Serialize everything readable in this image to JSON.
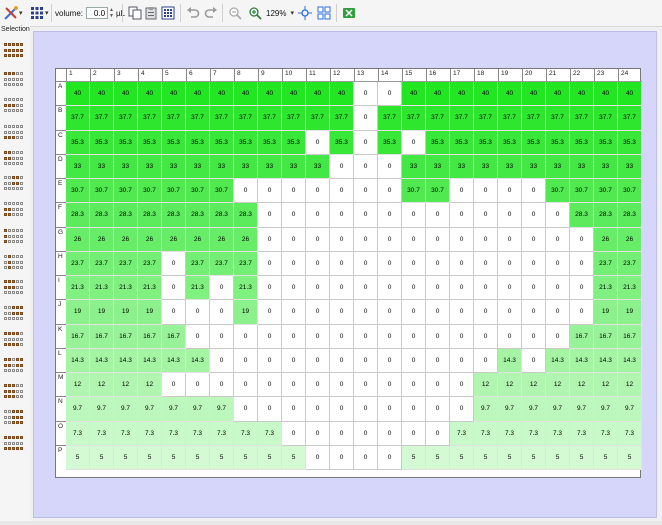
{
  "toolbar": {
    "volume_label": "volume:",
    "volume_value": "0.0",
    "volume_unit": "µL",
    "zoom_value": "129%",
    "icons": [
      "pipette-tool-icon",
      "plate-grid-icon",
      "copy-icon",
      "paste-icon",
      "plate-layout-icon",
      "undo-icon",
      "redo-icon",
      "zoom-out-icon",
      "zoom-in-icon",
      "fit-view-icon",
      "grid-view-icon",
      "export-excel-icon"
    ]
  },
  "sidebar": {
    "title": "Selection",
    "icons": [
      "select-all-icon",
      "select-rows-1-icon",
      "select-rows-2-icon",
      "select-rows-3-icon",
      "select-block-1-icon",
      "select-block-2-icon",
      "select-block-3-icon",
      "select-block-4-icon",
      "select-block-5-icon",
      "select-block-6-icon",
      "select-block-7-icon",
      "select-block-8-icon",
      "select-block-9-icon",
      "select-block-10-icon",
      "select-block-11-icon",
      "select-block-12-icon"
    ]
  },
  "plate": {
    "columns": [
      "1",
      "2",
      "3",
      "4",
      "5",
      "6",
      "7",
      "8",
      "9",
      "10",
      "11",
      "12",
      "13",
      "14",
      "15",
      "16",
      "17",
      "18",
      "19",
      "20",
      "21",
      "22",
      "23",
      "24"
    ],
    "rows": [
      "A",
      "B",
      "C",
      "D",
      "E",
      "F",
      "G",
      "H",
      "I",
      "J",
      "K",
      "L",
      "M",
      "N",
      "O",
      "P"
    ],
    "values": [
      [
        "40",
        "40",
        "40",
        "40",
        "40",
        "40",
        "40",
        "40",
        "40",
        "40",
        "40",
        "40",
        "0",
        "0",
        "40",
        "40",
        "40",
        "40",
        "40",
        "40",
        "40",
        "40",
        "40",
        "40"
      ],
      [
        "37.7",
        "37.7",
        "37.7",
        "37.7",
        "37.7",
        "37.7",
        "37.7",
        "37.7",
        "37.7",
        "37.7",
        "37.7",
        "37.7",
        "0",
        "37.7",
        "37.7",
        "37.7",
        "37.7",
        "37.7",
        "37.7",
        "37.7",
        "37.7",
        "37.7",
        "37.7",
        "37.7"
      ],
      [
        "35.3",
        "35.3",
        "35.3",
        "35.3",
        "35.3",
        "35.3",
        "35.3",
        "35.3",
        "35.3",
        "35.3",
        "0",
        "35.3",
        "0",
        "35.3",
        "0",
        "35.3",
        "35.3",
        "35.3",
        "35.3",
        "35.3",
        "35.3",
        "35.3",
        "35.3",
        "35.3"
      ],
      [
        "33",
        "33",
        "33",
        "33",
        "33",
        "33",
        "33",
        "33",
        "33",
        "33",
        "33",
        "0",
        "0",
        "0",
        "33",
        "33",
        "33",
        "33",
        "33",
        "33",
        "33",
        "33",
        "33",
        "33"
      ],
      [
        "30.7",
        "30.7",
        "30.7",
        "30.7",
        "30.7",
        "30.7",
        "30.7",
        "0",
        "0",
        "0",
        "0",
        "0",
        "0",
        "0",
        "30.7",
        "30.7",
        "0",
        "0",
        "0",
        "0",
        "30.7",
        "30.7",
        "30.7",
        "30.7"
      ],
      [
        "28.3",
        "28.3",
        "28.3",
        "28.3",
        "28.3",
        "28.3",
        "28.3",
        "28.3",
        "0",
        "0",
        "0",
        "0",
        "0",
        "0",
        "0",
        "0",
        "0",
        "0",
        "0",
        "0",
        "0",
        "28.3",
        "28.3",
        "28.3"
      ],
      [
        "26",
        "26",
        "26",
        "26",
        "26",
        "26",
        "26",
        "26",
        "0",
        "0",
        "0",
        "0",
        "0",
        "0",
        "0",
        "0",
        "0",
        "0",
        "0",
        "0",
        "0",
        "0",
        "26",
        "26"
      ],
      [
        "23.7",
        "23.7",
        "23.7",
        "23.7",
        "0",
        "23.7",
        "23.7",
        "23.7",
        "0",
        "0",
        "0",
        "0",
        "0",
        "0",
        "0",
        "0",
        "0",
        "0",
        "0",
        "0",
        "0",
        "0",
        "23.7",
        "23.7"
      ],
      [
        "21.3",
        "21.3",
        "21.3",
        "21.3",
        "0",
        "21.3",
        "0",
        "21.3",
        "0",
        "0",
        "0",
        "0",
        "0",
        "0",
        "0",
        "0",
        "0",
        "0",
        "0",
        "0",
        "0",
        "0",
        "21.3",
        "21.3"
      ],
      [
        "19",
        "19",
        "19",
        "19",
        "0",
        "0",
        "0",
        "19",
        "0",
        "0",
        "0",
        "0",
        "0",
        "0",
        "0",
        "0",
        "0",
        "0",
        "0",
        "0",
        "0",
        "0",
        "19",
        "19"
      ],
      [
        "16.7",
        "16.7",
        "16.7",
        "16.7",
        "16.7",
        "0",
        "0",
        "0",
        "0",
        "0",
        "0",
        "0",
        "0",
        "0",
        "0",
        "0",
        "0",
        "0",
        "0",
        "0",
        "0",
        "16.7",
        "16.7",
        "16.7"
      ],
      [
        "14.3",
        "14.3",
        "14.3",
        "14.3",
        "14.3",
        "14.3",
        "0",
        "0",
        "0",
        "0",
        "0",
        "0",
        "0",
        "0",
        "0",
        "0",
        "0",
        "0",
        "14.3",
        "0",
        "14.3",
        "14.3",
        "14.3",
        "14.3"
      ],
      [
        "12",
        "12",
        "12",
        "12",
        "0",
        "0",
        "0",
        "0",
        "0",
        "0",
        "0",
        "0",
        "0",
        "0",
        "0",
        "0",
        "0",
        "12",
        "12",
        "12",
        "12",
        "12",
        "12",
        "12"
      ],
      [
        "9.7",
        "9.7",
        "9.7",
        "9.7",
        "9.7",
        "9.7",
        "9.7",
        "0",
        "0",
        "0",
        "0",
        "0",
        "0",
        "0",
        "0",
        "0",
        "0",
        "9.7",
        "9.7",
        "9.7",
        "9.7",
        "9.7",
        "9.7",
        "9.7"
      ],
      [
        "7.3",
        "7.3",
        "7.3",
        "7.3",
        "7.3",
        "7.3",
        "7.3",
        "7.3",
        "7.3",
        "0",
        "0",
        "0",
        "0",
        "0",
        "0",
        "0",
        "7.3",
        "7.3",
        "7.3",
        "7.3",
        "7.3",
        "7.3",
        "7.3",
        "7.3"
      ],
      [
        "5",
        "5",
        "5",
        "5",
        "5",
        "5",
        "5",
        "5",
        "5",
        "5",
        "0",
        "0",
        "0",
        "0",
        "5",
        "5",
        "5",
        "5",
        "5",
        "5",
        "5",
        "5",
        "5",
        "5"
      ]
    ],
    "colors": {
      "40": "#22e622",
      "37.7": "#2ee62e",
      "35.3": "#39e739",
      "33": "#44e844",
      "30.7": "#50ea50",
      "28.3": "#5ceb5c",
      "26": "#68ed68",
      "23.7": "#74ee74",
      "21.3": "#80f080",
      "19": "#8cf18c",
      "16.7": "#98f398",
      "14.3": "#a4f4a4",
      "12": "#b0f6b0",
      "9.7": "#bcf7bc",
      "7.3": "#c8f9c8",
      "5": "#d4fad4"
    }
  }
}
